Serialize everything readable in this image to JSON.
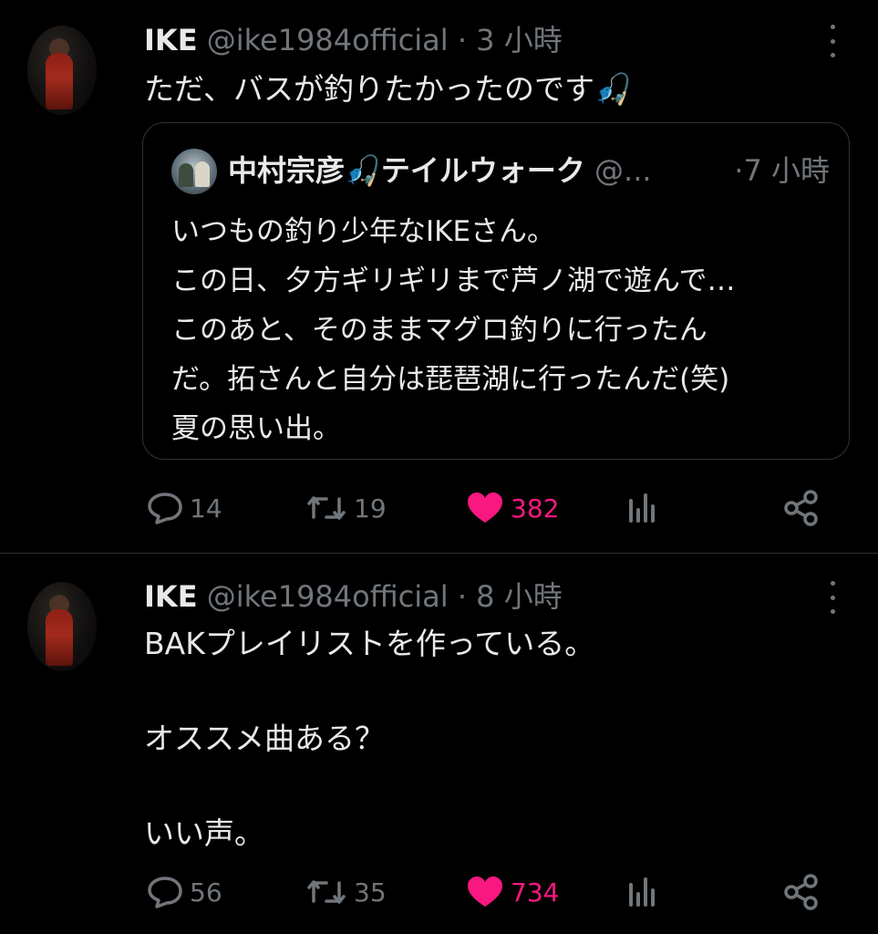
{
  "tweets": [
    {
      "name": "IKE",
      "handle": "@ike1984official",
      "separator": "·",
      "time": "3 小時",
      "text": "ただ、バスが釣りたかったのです🎣",
      "quote": {
        "name": "中村宗彦🎣テイルウォーク",
        "handle": "@...",
        "time": "·7 小時",
        "text": "いつもの釣り少年なIKEさん。\nこの日、夕方ギリギリまで芦ノ湖で遊んで…\nこのあと、そのままマグロ釣りに行ったん\nだ。拓さんと自分は琵琶湖に行ったんだ(笑)\n夏の思い出。"
      },
      "replies": "14",
      "retweets": "19",
      "likes": "382"
    },
    {
      "name": "IKE",
      "handle": "@ike1984official",
      "separator": "·",
      "time": "8 小時",
      "text": "BAKプレイリストを作っている。\n\nオススメ曲ある？\n\nいい声。",
      "replies": "56",
      "retweets": "35",
      "likes": "734"
    }
  ],
  "colors": {
    "like": "#f91880",
    "muted": "#71767b",
    "text": "#e7e9ea",
    "border": "#2f3336"
  },
  "icons": [
    "reply-icon",
    "retweet-icon",
    "like-icon",
    "views-icon",
    "share-icon",
    "more-icon"
  ]
}
